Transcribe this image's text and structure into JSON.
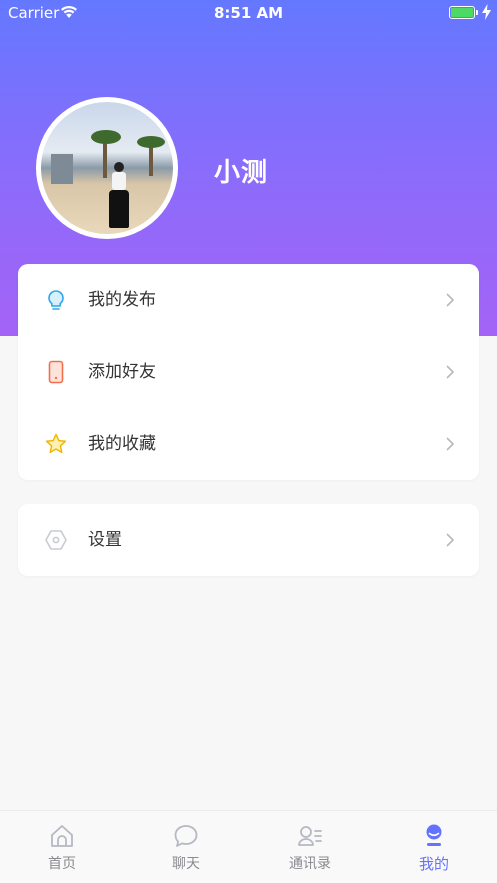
{
  "status_bar": {
    "carrier": "Carrier",
    "time": "8:51 AM"
  },
  "profile": {
    "username": "小测"
  },
  "menu_group_1": [
    {
      "label": "我的发布",
      "icon": "lightbulb-icon"
    },
    {
      "label": "添加好友",
      "icon": "phone-icon"
    },
    {
      "label": "我的收藏",
      "icon": "star-icon"
    }
  ],
  "menu_group_2": [
    {
      "label": "设置",
      "icon": "hexagon-settings-icon"
    }
  ],
  "tabbar": {
    "tabs": [
      {
        "label": "首页",
        "icon": "home-icon"
      },
      {
        "label": "聊天",
        "icon": "chat-icon"
      },
      {
        "label": "通讯录",
        "icon": "contacts-icon"
      },
      {
        "label": "我的",
        "icon": "profile-icon"
      }
    ],
    "active_index": 3
  },
  "colors": {
    "header_top": "#6478ff",
    "header_bottom": "#a463f6",
    "accent": "#6473ff",
    "battery": "#4cd964"
  }
}
